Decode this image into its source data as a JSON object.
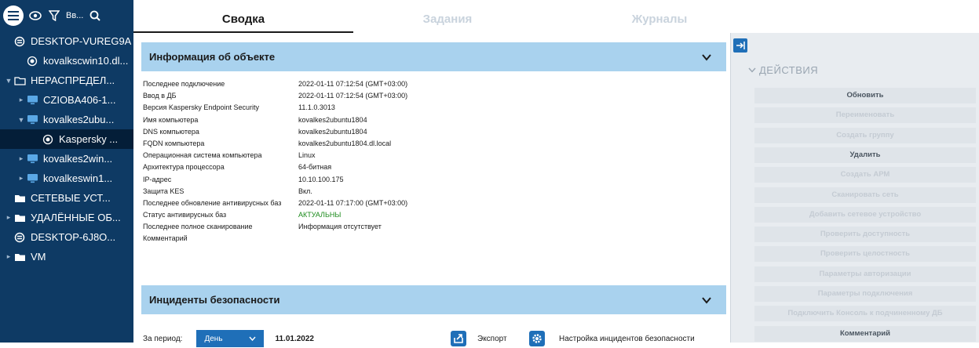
{
  "toolbar": {
    "search_text": "Вв..."
  },
  "tree": [
    {
      "label": "DESKTOP-VUREG9A",
      "icon": "server-icon",
      "caret": ""
    },
    {
      "label": "kovalkscwin10.dl...",
      "icon": "node-icon",
      "caret": ""
    },
    {
      "label": "НЕРАСПРЕДЕЛ...",
      "icon": "folder-outline-icon",
      "caret": "▼"
    },
    {
      "label": "CZIOBA406-1...",
      "icon": "computer-icon",
      "caret": "▸"
    },
    {
      "label": "kovalkes2ubu...",
      "icon": "computer-icon",
      "caret": "▼"
    },
    {
      "label": "Kaspersky ...",
      "icon": "node-icon",
      "caret": ""
    },
    {
      "label": "kovalkes2win...",
      "icon": "computer-icon",
      "caret": "▸"
    },
    {
      "label": "kovalkeswin1...",
      "icon": "computer-icon",
      "caret": "▸"
    },
    {
      "label": "СЕТЕВЫЕ УСТ...",
      "icon": "folder-icon",
      "caret": ""
    },
    {
      "label": "УДАЛЁННЫЕ ОБ...",
      "icon": "folder-icon",
      "caret": "▸"
    },
    {
      "label": "DESKTOP-6J8O...",
      "icon": "server-icon",
      "caret": ""
    },
    {
      "label": "VM",
      "icon": "folder-icon",
      "caret": "▸"
    }
  ],
  "tabs": [
    "Сводка",
    "Задания",
    "Журналы"
  ],
  "object_info": {
    "title": "Информация об объекте",
    "rows": [
      {
        "key": "Последнее подключение",
        "value": "2022-01-11 07:12:54 (GMT+03:00)"
      },
      {
        "key": "Ввод в ДБ",
        "value": "2022-01-11 07:12:54 (GMT+03:00)"
      },
      {
        "key": "Версия Kaspersky Endpoint Security",
        "value": "11.1.0.3013"
      },
      {
        "key": "Имя компьютера",
        "value": "kovalkes2ubuntu1804"
      },
      {
        "key": "DNS компьютера",
        "value": "kovalkes2ubuntu1804"
      },
      {
        "key": "FQDN компьютера",
        "value": "kovalkes2ubuntu1804.dl.local"
      },
      {
        "key": "Операционная система компьютера",
        "value": "Linux"
      },
      {
        "key": "Архитектура процессора",
        "value": "64-битная"
      },
      {
        "key": "IP-адрес",
        "value": "10.10.100.175"
      },
      {
        "key": "Защита KES",
        "value": "Вкл."
      },
      {
        "key": "Последнее обновление антивирусных баз",
        "value": "2022-01-11 07:17:00 (GMT+03:00)"
      },
      {
        "key": "Статус антивирусных баз",
        "value": "АКТУАЛЬНЫ",
        "status_color": "#1a8a1a"
      },
      {
        "key": "Последнее полное сканирование",
        "value": "Информация отсутствует"
      },
      {
        "key": "Комментарий",
        "value": ""
      }
    ]
  },
  "incidents": {
    "title": "Инциденты безопасности",
    "period_label": "За период:",
    "period_value": "День",
    "date": "11.01.2022",
    "export_label": "Экспорт",
    "settings_label": "Настройка инцидентов безопасности"
  },
  "actions": {
    "header": "ДЕЙСТВИЯ",
    "buttons": [
      {
        "label": "Обновить",
        "enabled": true
      },
      {
        "label": "Переименовать",
        "enabled": false
      },
      {
        "label": "Создать группу",
        "enabled": false
      },
      {
        "label": "Удалить",
        "enabled": true
      },
      {
        "label": "Создать АРМ",
        "enabled": false
      },
      {
        "label": "Сканировать сеть",
        "enabled": false
      },
      {
        "label": "Добавить сетевое устройство",
        "enabled": false
      },
      {
        "label": "Проверить доступность",
        "enabled": false
      },
      {
        "label": "Проверить целостность",
        "enabled": false
      },
      {
        "label": "Параметры авторизации",
        "enabled": false
      },
      {
        "label": "Параметры подключения",
        "enabled": false
      },
      {
        "label": "Подключить Консоль к подчиненному ДБ",
        "enabled": false
      },
      {
        "label": "Комментарий",
        "enabled": true
      }
    ]
  },
  "colors": {
    "sidebar_bg": "#0e3a64",
    "section_header_bg": "#a9d2ee",
    "accent": "#1f6fb8",
    "status_ok": "#1a8a1a"
  }
}
